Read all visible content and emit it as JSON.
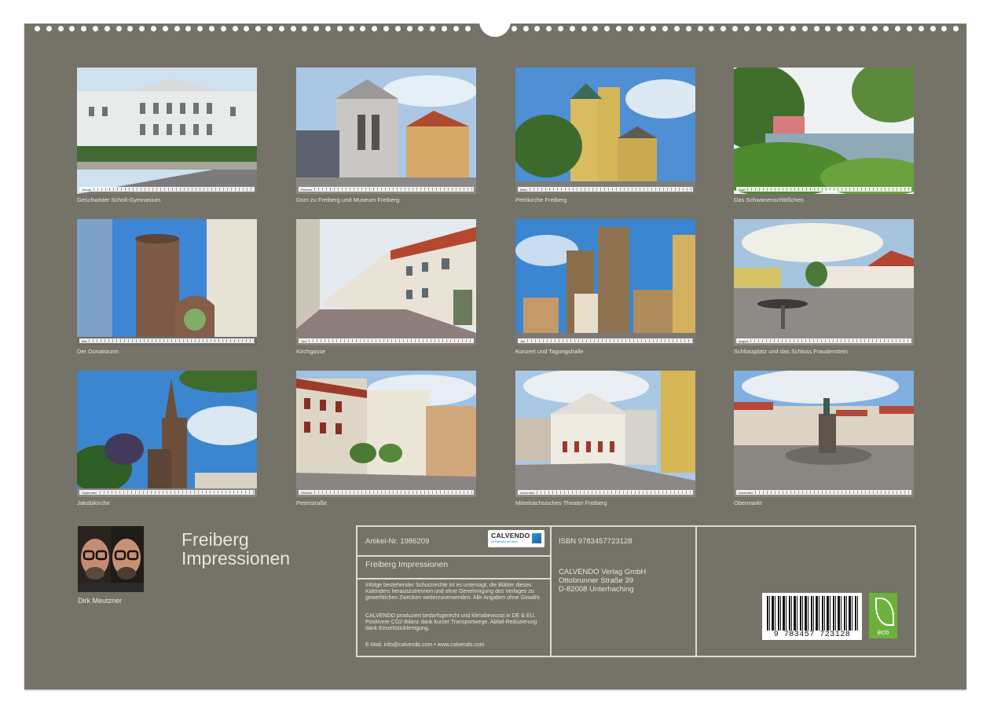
{
  "months": [
    {
      "caption": "Geschwister Scholl-Gymnasium",
      "month": "Januar"
    },
    {
      "caption": "Dom zu Freiberg und Museum Freiberg",
      "month": "Februar"
    },
    {
      "caption": "Petrikirche Freiberg",
      "month": "März"
    },
    {
      "caption": "Das Schwanenschlößchen",
      "month": "April"
    },
    {
      "caption": "Der Donatsturm",
      "month": "Mai"
    },
    {
      "caption": "Kirchgasse",
      "month": "Juni"
    },
    {
      "caption": "Konzert und Tagungshalle",
      "month": "Juli"
    },
    {
      "caption": "Schlossplatz und das Schloss Fraudenstein",
      "month": "August"
    },
    {
      "caption": "Jakobikirche",
      "month": "September"
    },
    {
      "caption": "Peterstraße",
      "month": "Oktober"
    },
    {
      "caption": "Mittelsächsisches Theater Freiberg",
      "month": "November"
    },
    {
      "caption": "Obermarkt",
      "month": "Dezember"
    }
  ],
  "author": {
    "name": "Dirk Meutzner"
  },
  "title": {
    "line1": "Freiberg",
    "line2": "Impressionen"
  },
  "info": {
    "article": "Artikel-Nr. 1986209",
    "calendar_title": "Freiberg Impressionen",
    "legal1": "Infolge bestehender Schutzrechte ist es untersagt, die Blätter dieses Kalenders herauszutrennen und ohne Genehmigung des Verlages zu gewerblichen Zwecken weiterzuverwenden. Alle Angaben ohne Gewähr.",
    "legal2": "CALVENDO produziert bedarfsgerecht und klimabewusst in DE & EU. Positivere CO2-Bilanz dank kurzer Transportwege. Abfall-Reduzierung dank Einzelstückfertigung.",
    "email": "E-Mail: info@calvendo.com • www.calvendo.com",
    "isbn": "ISBN 9783457723128",
    "publisher1": "CALVENDO Verlag GmbH",
    "publisher2": "Ottobrunner Straße 39",
    "publisher3": "D-82008 Unterhaching",
    "barcode_number": "9 783457 723128",
    "logo_text": "CALVENDO",
    "logo_sub": "Ihr Kalender auf Abruf",
    "eco_label": "eco"
  },
  "colors": {
    "board": "#757268",
    "caption": "#e8e6df",
    "frame": "#dcdad3",
    "eco": "#6ab23a"
  }
}
